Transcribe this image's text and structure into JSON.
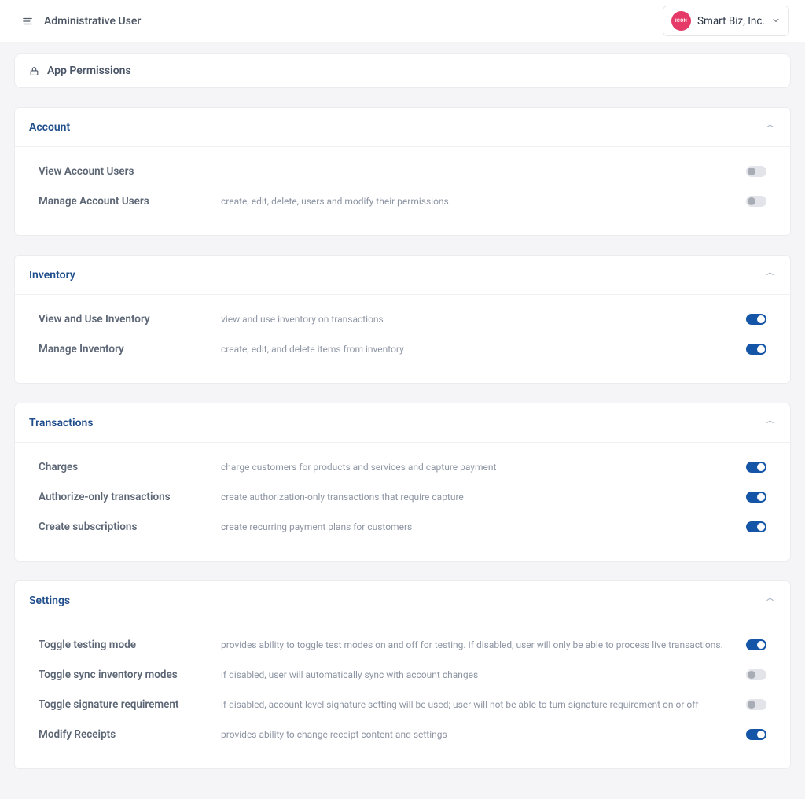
{
  "header": {
    "page_title": "Administrative User",
    "org_name": "Smart Biz, Inc.",
    "avatar_text": "ICON"
  },
  "panel": {
    "title": "App Permissions"
  },
  "sections": [
    {
      "title": "Account",
      "items": [
        {
          "label": "View Account Users",
          "desc": "",
          "on": false
        },
        {
          "label": "Manage Account Users",
          "desc": "create, edit, delete, users and modify their permissions.",
          "on": false
        }
      ]
    },
    {
      "title": "Inventory",
      "items": [
        {
          "label": "View and Use Inventory",
          "desc": "view and use inventory on transactions",
          "on": true
        },
        {
          "label": "Manage Inventory",
          "desc": "create, edit, and delete items from inventory",
          "on": true
        }
      ]
    },
    {
      "title": "Transactions",
      "items": [
        {
          "label": "Charges",
          "desc": "charge customers for products and services and capture payment",
          "on": true
        },
        {
          "label": "Authorize-only transactions",
          "desc": "create authorization-only transactions that require capture",
          "on": true
        },
        {
          "label": "Create subscriptions",
          "desc": "create recurring payment plans for customers",
          "on": true
        }
      ]
    },
    {
      "title": "Settings",
      "items": [
        {
          "label": "Toggle testing mode",
          "desc": "provides ability to toggle test modes on and off for testing. If disabled, user will only be able to process live transactions.",
          "on": true
        },
        {
          "label": "Toggle sync inventory modes",
          "desc": "if disabled, user will automatically sync with account changes",
          "on": false
        },
        {
          "label": "Toggle signature requirement",
          "desc": "if disabled, account-level signature setting will be used; user will not be able to turn signature requirement on or off",
          "on": false
        },
        {
          "label": "Modify Receipts",
          "desc": "provides ability to change receipt content and settings",
          "on": true
        }
      ]
    }
  ]
}
